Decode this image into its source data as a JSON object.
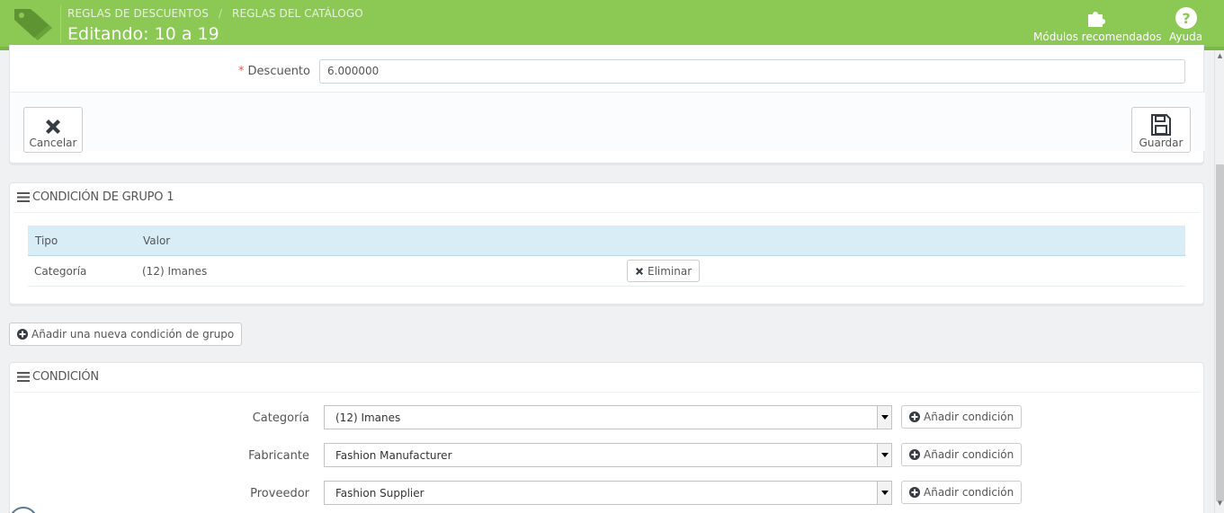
{
  "header": {
    "breadcrumb": [
      "REGLAS DE DESCUENTOS",
      "REGLAS DEL CATÁLOGO"
    ],
    "breadcrumb_separator": "/",
    "title": "Editando: 10 a 19",
    "buttons": {
      "modules": "Módulos recomendados",
      "help": "Ayuda"
    },
    "bg_color": "#8bc954"
  },
  "form": {
    "required_mark": "*",
    "discount_label": "Descuento",
    "discount_value": "6.000000",
    "cancel_label": "Cancelar",
    "save_label": "Guardar"
  },
  "group_panel": {
    "title": "CONDICIÓN DE GRUPO 1",
    "columns": [
      "Tipo",
      "Valor"
    ],
    "rows": [
      {
        "type": "Categoría",
        "value": "(12) Imanes",
        "action": "Eliminar"
      }
    ]
  },
  "add_group_button": "Añadir una nueva condición de grupo",
  "condition_panel": {
    "title": "CONDICIÓN",
    "fields": [
      {
        "label": "Categoría",
        "selected": "(12) Imanes",
        "button": "Añadir condición"
      },
      {
        "label": "Fabricante",
        "selected": "Fashion Manufacturer",
        "button": "Añadir condición"
      },
      {
        "label": "Proveedor",
        "selected": "Fashion Supplier",
        "button": "Añadir condición"
      }
    ]
  },
  "icons": {
    "logo": "tags-icon",
    "modules": "puzzle-icon",
    "help": "question-circle-icon",
    "cancel": "close-icon",
    "save": "floppy-disk-icon",
    "list": "list-icon",
    "remove": "times-icon",
    "add": "plus-circle-icon",
    "select_arrow": "caret-down-icon"
  }
}
